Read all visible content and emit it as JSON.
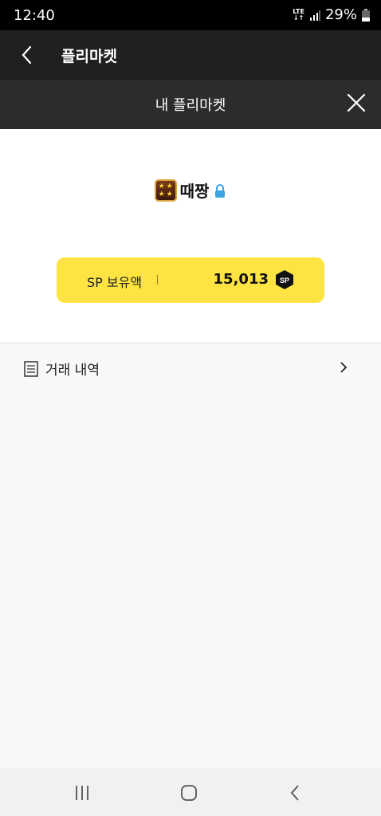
{
  "status": {
    "time": "12:40",
    "network_top": "LTE",
    "battery": "29%"
  },
  "header": {
    "title": "플리마켓",
    "back_icon": "chevron-left-icon"
  },
  "subheader": {
    "title": "내 플리마켓",
    "close_icon": "close-icon"
  },
  "profile": {
    "nickname": "때짱",
    "rank_icon": "rank-badge-icon",
    "lock_icon": "lock-icon",
    "lock_color": "#3aa3e0"
  },
  "sp": {
    "label": "SP 보유액",
    "value": "15,013",
    "badge": "SP",
    "card_color": "#fee442"
  },
  "history": {
    "label": "거래 내역",
    "icon": "document-icon",
    "chevron": "chevron-right-icon"
  },
  "navbar": {
    "recent": "recent-apps-icon",
    "home": "home-icon",
    "back": "back-icon"
  }
}
